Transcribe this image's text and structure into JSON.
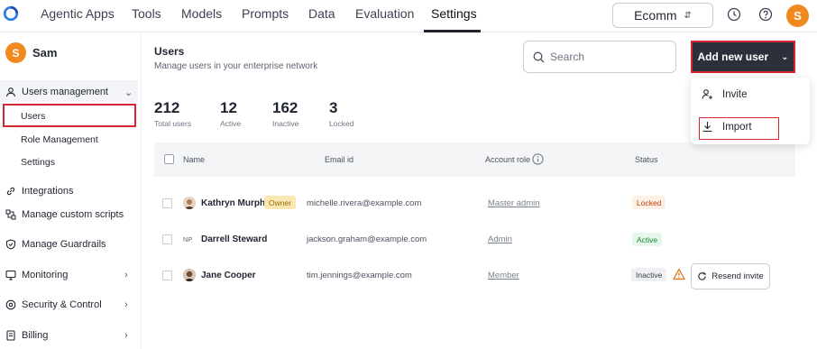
{
  "top_nav": {
    "items": [
      {
        "label": "Agentic Apps"
      },
      {
        "label": "Tools"
      },
      {
        "label": "Models"
      },
      {
        "label": "Prompts"
      },
      {
        "label": "Data"
      },
      {
        "label": "Evaluation"
      },
      {
        "label": "Settings",
        "active": true
      }
    ],
    "workspace": "Ecomm",
    "user_initial": "S"
  },
  "sidebar": {
    "user_name": "Sam",
    "user_initial": "S",
    "group_label": "Users management",
    "sub_items": [
      "Users",
      "Role Management",
      "Settings"
    ],
    "active_sub_item": "Users",
    "items": [
      {
        "label": "Integrations",
        "icon": "link-icon"
      },
      {
        "label": "Manage custom scripts",
        "icon": "scripts-icon"
      },
      {
        "label": "Manage Guardrails",
        "icon": "shield-icon"
      },
      {
        "label": "Monitoring",
        "icon": "monitor-icon",
        "expandable": true
      },
      {
        "label": "Security & Control",
        "icon": "security-icon",
        "expandable": true
      },
      {
        "label": "Billing",
        "icon": "billing-icon",
        "expandable": true
      }
    ]
  },
  "header": {
    "title": "Users",
    "subtitle": "Manage users in your enterprise network",
    "search_placeholder": "Search",
    "add_button_label": "Add new user"
  },
  "stats": [
    {
      "value": "212",
      "label": "Total users"
    },
    {
      "value": "12",
      "label": "Active"
    },
    {
      "value": "162",
      "label": "Inactive"
    },
    {
      "value": "3",
      "label": "Locked"
    }
  ],
  "table": {
    "columns": [
      "Name",
      "Email id",
      "Account role",
      "Status"
    ],
    "rows": [
      {
        "name": "Kathryn Murphy",
        "badge": "Owner",
        "email": "michelle.rivera@example.com",
        "role": "Master admin",
        "status": "Locked"
      },
      {
        "name": "Darrell Steward",
        "initials": "NP",
        "email": "jackson.graham@example.com",
        "role": "Admin",
        "status": "Active"
      },
      {
        "name": "Jane Cooper",
        "email": "tim.jennings@example.com",
        "role": "Member",
        "status": "Inactive",
        "action": "Resend invite"
      }
    ]
  },
  "dropdown": {
    "items": [
      "Invite",
      "Import"
    ],
    "highlighted": "Import"
  },
  "colors": {
    "accent_orange": "#f08a1e",
    "dark_button": "#2c303a",
    "highlight_red": "#d62631"
  }
}
